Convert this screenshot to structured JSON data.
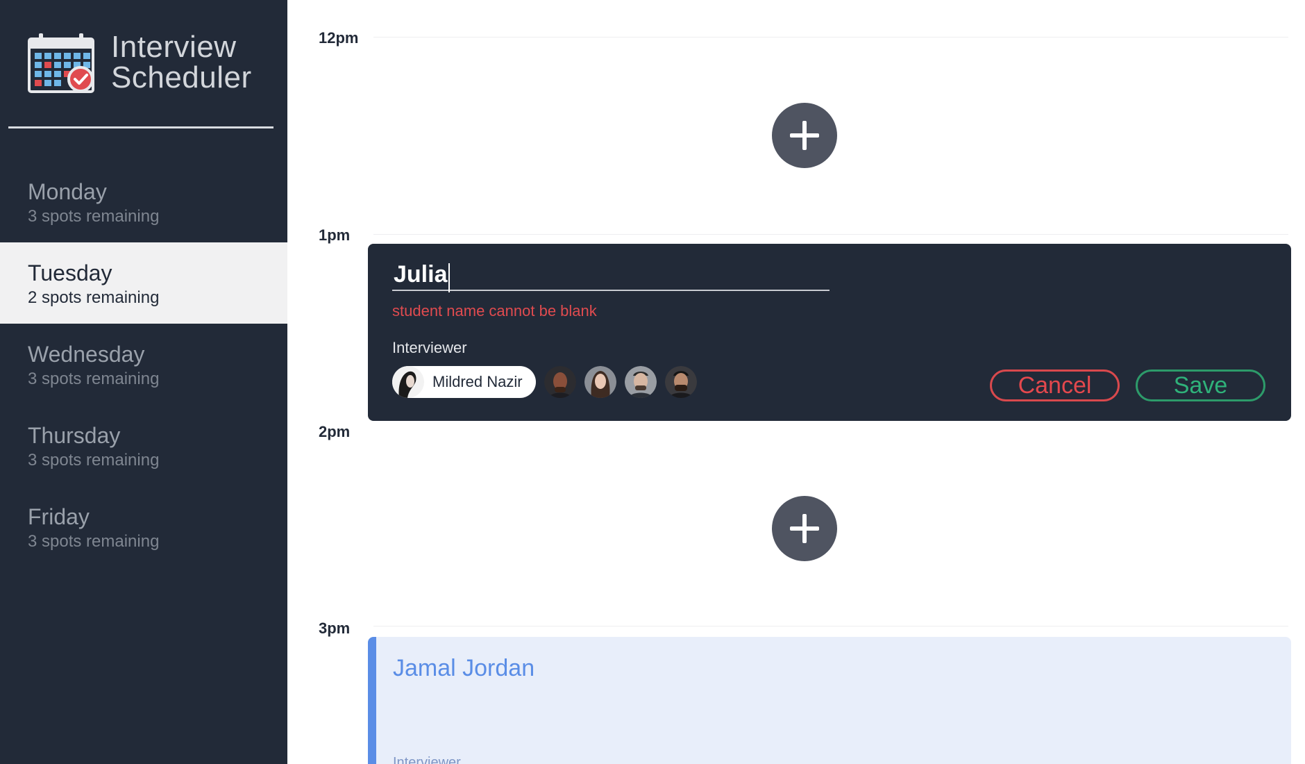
{
  "app": {
    "title_line1": "Interview",
    "title_line2": "Scheduler"
  },
  "days": [
    {
      "name": "Monday",
      "spots": "3 spots remaining"
    },
    {
      "name": "Tuesday",
      "spots": "2 spots remaining",
      "selected": true
    },
    {
      "name": "Wednesday",
      "spots": "3 spots remaining"
    },
    {
      "name": "Thursday",
      "spots": "3 spots remaining"
    },
    {
      "name": "Friday",
      "spots": "3 spots remaining"
    }
  ],
  "schedule": {
    "times": [
      "12pm",
      "1pm",
      "2pm",
      "3pm"
    ]
  },
  "form": {
    "student_value": "Julia",
    "error": "student name cannot be blank",
    "interviewer_label": "Interviewer",
    "selected_interviewer": "Mildred Nazir",
    "cancel_label": "Cancel",
    "save_label": "Save"
  },
  "booked": {
    "student": "Jamal Jordan",
    "interviewer_label": "Interviewer"
  },
  "colors": {
    "sidebar": "#222a38",
    "danger": "#e4484d",
    "confirm": "#2fb27a",
    "booked_accent": "#5a8de6"
  },
  "icons": {
    "logo": "calendar-check-icon",
    "add": "plus-icon"
  }
}
